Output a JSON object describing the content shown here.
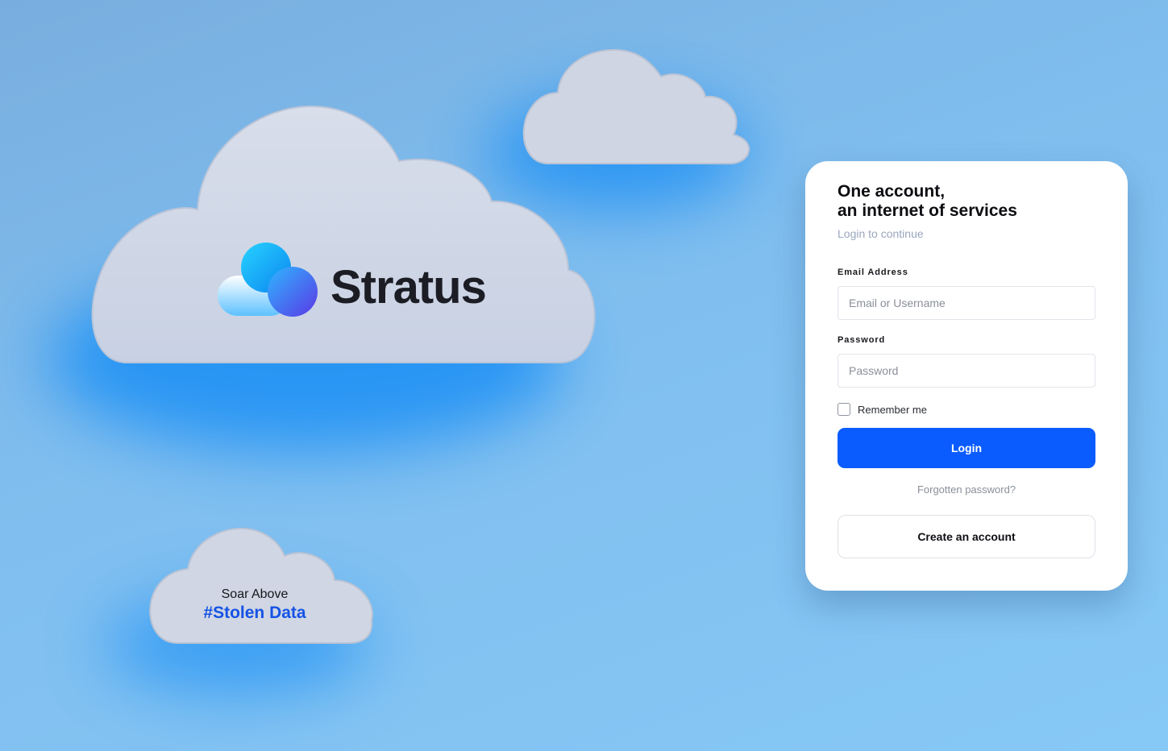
{
  "brand": {
    "name": "Stratus",
    "tagline_line1": "Soar Above",
    "tagline_line2": "#Stolen Data"
  },
  "login_card": {
    "title_line1": "One account,",
    "title_line2": "an internet of services",
    "subtitle": "Login to continue",
    "email_label": "Email Address",
    "email_placeholder": "Email or Username",
    "email_value": "",
    "password_label": "Password",
    "password_placeholder": "Password",
    "password_value": "",
    "remember_label": "Remember me",
    "remember_checked": false,
    "login_button": "Login",
    "forgot_link": "Forgotten password?",
    "create_button": "Create an account"
  },
  "colors": {
    "background": "#7fbdee",
    "accent": "#0b5cff",
    "tagline_accent": "#1553e6",
    "cloud": "#d0d8e8"
  },
  "icons": {
    "logo": "stratus-logo-icon",
    "clouds": [
      "cloud-large-icon",
      "cloud-top-right-icon",
      "cloud-small-icon"
    ]
  }
}
